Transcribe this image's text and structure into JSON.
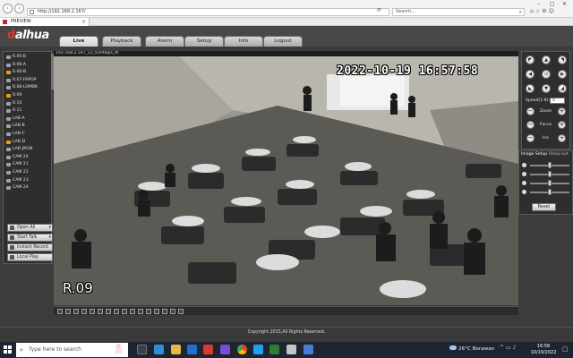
{
  "browser": {
    "url": "http://192.168.2.167/",
    "search_placeholder": "Search...",
    "tab_title": "PREVIEW",
    "tab_close": "×",
    "back_icon": "‹",
    "forward_icon": "›"
  },
  "app": {
    "logo": "alhua",
    "logo_mark": "d",
    "nav_tabs": [
      "Live",
      "Playback",
      "Alarm",
      "Setup",
      "Info",
      "Logout"
    ],
    "active_tab": "Live"
  },
  "channels": [
    {
      "label": "R.05-B",
      "active": false
    },
    {
      "label": "R.06-A",
      "active": false
    },
    {
      "label": "R.06-B",
      "active": true
    },
    {
      "label": "R.07-FAPGP",
      "active": false
    },
    {
      "label": "R.08-LOMBK",
      "active": false
    },
    {
      "label": "R.09",
      "active": true
    },
    {
      "label": "R.10",
      "active": false
    },
    {
      "label": "R.11",
      "active": false
    },
    {
      "label": "LAB-A",
      "active": false
    },
    {
      "label": "LAB-B",
      "active": false
    },
    {
      "label": "LAB-C",
      "active": false
    },
    {
      "label": "LAB-D",
      "active": true
    },
    {
      "label": "LAB-JRGN",
      "active": false
    },
    {
      "label": "CAM 20",
      "active": false
    },
    {
      "label": "CAM 21",
      "active": false
    },
    {
      "label": "CAM 22",
      "active": false
    },
    {
      "label": "CAM 23",
      "active": false
    },
    {
      "label": "CAM 24",
      "active": false
    }
  ],
  "side_buttons": {
    "open_all": "Open All",
    "start_talk": "Start Talk",
    "instant_record": "Instant Record",
    "local_play": "Local Play"
  },
  "video": {
    "header": "192.168.2.167_12_9206bps_M",
    "timestamp": "2022-10-19 16:57:58",
    "channel_label": "R.09"
  },
  "ptz": {
    "speed_label": "Speed(1-8):",
    "speed_value": "5",
    "zoom_label": "Zoom",
    "focus_label": "Focus",
    "iris_label": "Iris",
    "minus": "−",
    "plus": "+"
  },
  "image_setup": {
    "tab_image": "Image Setup",
    "tab_relay": "Relay-out",
    "sliders": [
      {
        "name": "brightness",
        "level": 0.5
      },
      {
        "name": "contrast",
        "level": 0.5
      },
      {
        "name": "hue",
        "level": 0.5
      },
      {
        "name": "saturation",
        "level": 0.5
      }
    ],
    "reset": "Reset"
  },
  "footer": {
    "copyright": "Copyright 2015,All Rights Reserved."
  },
  "taskbar": {
    "search_placeholder": "Type here to search",
    "weather_temp": "26°C",
    "weather_text": "Berawan",
    "time": "16:58",
    "date": "10/19/2022"
  },
  "colors": {
    "accent_orange": "#f09a1c",
    "logo_red": "#e2342b"
  }
}
